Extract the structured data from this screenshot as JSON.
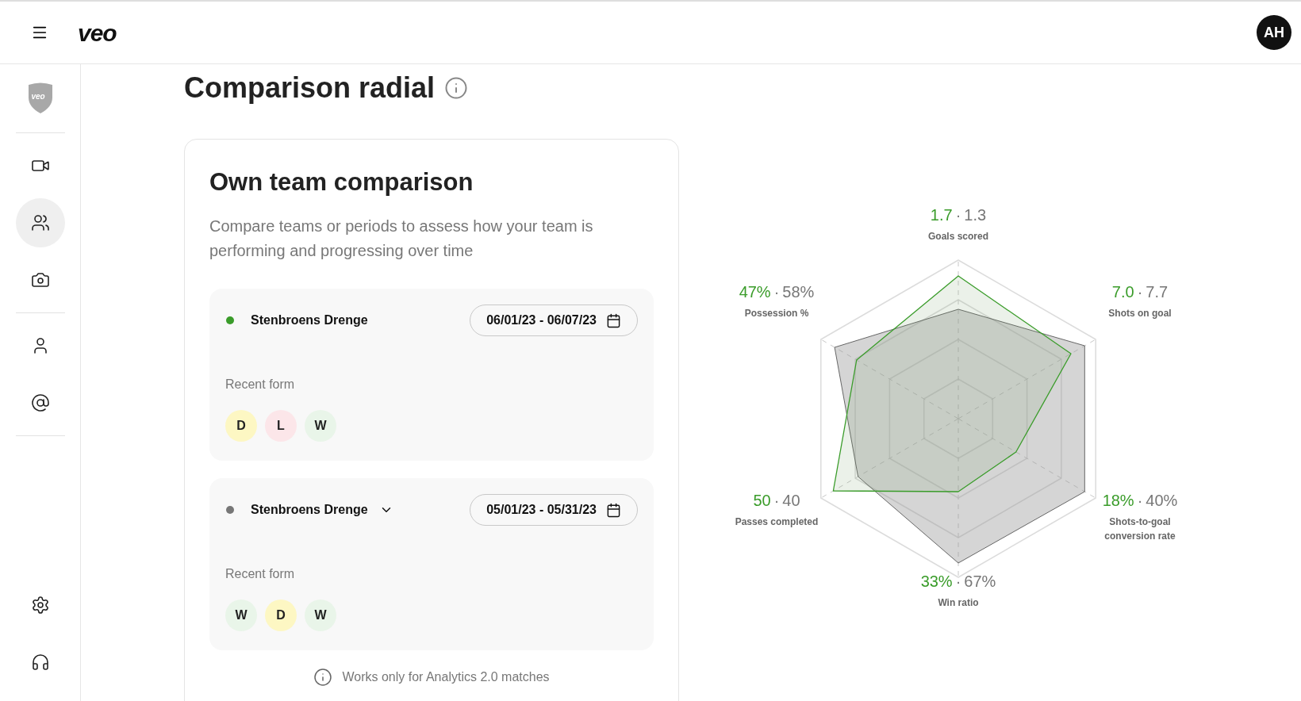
{
  "header": {
    "logo": "veo",
    "avatar": "AH"
  },
  "sidebar": {
    "badge": "veo",
    "items": [
      {
        "selected": false
      },
      {
        "selected": true
      },
      {
        "selected": false
      },
      {
        "selected": false
      },
      {
        "selected": false
      },
      {
        "selected": false
      },
      {
        "selected": false
      }
    ]
  },
  "page_title": "Comparison radial",
  "card": {
    "title": "Own team comparison",
    "description": "Compare teams or periods to assess how your team is performing and progressing over time",
    "teams": [
      {
        "name": "Stenbroens Drenge",
        "color": "#3a9c2a",
        "has_dropdown": false,
        "date_range": "06/01/23 - 06/07/23",
        "form_label": "Recent form",
        "form": [
          {
            "result": "D",
            "color": "#fdf7c3"
          },
          {
            "result": "L",
            "color": "#fce6e9"
          },
          {
            "result": "W",
            "color": "#e9f5e9"
          }
        ]
      },
      {
        "name": "Stenbroens Drenge",
        "color": "#777777",
        "has_dropdown": true,
        "date_range": "05/01/23 - 05/31/23",
        "form_label": "Recent form",
        "form": [
          {
            "result": "W",
            "color": "#e9f5e9"
          },
          {
            "result": "D",
            "color": "#fdf7c3"
          },
          {
            "result": "W",
            "color": "#e9f5e9"
          }
        ]
      }
    ],
    "note": "Works only for Analytics 2.0 matches"
  },
  "radar": {
    "axes": [
      {
        "label": "Goals scored",
        "own_value": "1.7",
        "separator": "·",
        "compare_value": "1.3"
      },
      {
        "label": "Possession %",
        "own_value": "47%",
        "separator": "·",
        "compare_value": "58%"
      },
      {
        "label": "Shots on goal",
        "own_value": "7.0",
        "separator": "·",
        "compare_value": "7.7"
      },
      {
        "label": "Passes completed",
        "own_value": "50",
        "separator": "·",
        "compare_value": "40"
      },
      {
        "label": "Shots-to-goal conversion rate",
        "own_value": "18%",
        "separator": "·",
        "compare_value": "40%"
      },
      {
        "label": "Win ratio",
        "own_value": "33%",
        "separator": "·",
        "compare_value": "67%"
      }
    ]
  }
}
